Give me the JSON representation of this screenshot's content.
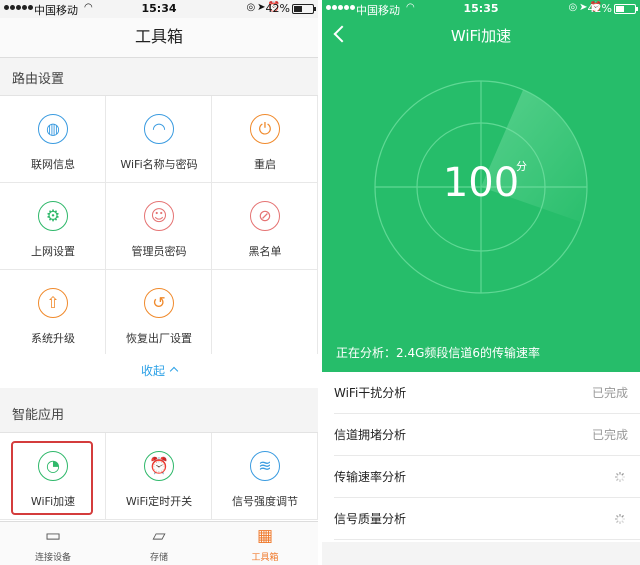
{
  "left": {
    "status": {
      "carrier": "中国移动",
      "time": "15:34",
      "battery": "42%",
      "battery_level": 0.42
    },
    "title": "工具箱",
    "router_section": {
      "title": "路由设置",
      "items": [
        {
          "label": "联网信息",
          "icon": "globe-icon",
          "color": "#3a9be0"
        },
        {
          "label": "WiFi名称与密码",
          "icon": "wifi-icon",
          "color": "#3a9be0"
        },
        {
          "label": "重启",
          "icon": "power-icon",
          "color": "#f08a2c"
        },
        {
          "label": "上网设置",
          "icon": "gear-icon",
          "color": "#2fb86a"
        },
        {
          "label": "管理员密码",
          "icon": "user-icon",
          "color": "#e57373"
        },
        {
          "label": "黑名单",
          "icon": "blacklist-icon",
          "color": "#e57373"
        },
        {
          "label": "系统升级",
          "icon": "upgrade-icon",
          "color": "#f08a2c"
        },
        {
          "label": "恢复出厂设置",
          "icon": "restore-icon",
          "color": "#f08a2c"
        }
      ],
      "collapse_label": "收起"
    },
    "smart_section": {
      "title": "智能应用",
      "items": [
        {
          "label": "WiFi加速",
          "icon": "speedometer-icon",
          "color": "#2fb86a"
        },
        {
          "label": "WiFi定时开关",
          "icon": "alarm-clock-icon",
          "color": "#2fb86a"
        },
        {
          "label": "信号强度调节",
          "icon": "signal-icon",
          "color": "#3a9be0"
        }
      ]
    },
    "tabs": [
      {
        "label": "连接设备",
        "icon": "monitor-icon"
      },
      {
        "label": "存储",
        "icon": "storage-icon"
      },
      {
        "label": "工具箱",
        "icon": "toolbox-icon",
        "active": true
      }
    ],
    "accent": "#f07a2c"
  },
  "right": {
    "status": {
      "carrier": "中国移动",
      "time": "15:35",
      "battery": "42%",
      "battery_level": 0.42
    },
    "title": "WiFi加速",
    "score": "100",
    "unit": "分",
    "analyzing": "正在分析：2.4G频段信道6的传输速率",
    "rows": [
      {
        "label": "WiFi干扰分析",
        "status": "已完成"
      },
      {
        "label": "信道拥堵分析",
        "status": "已完成"
      },
      {
        "label": "传输速率分析",
        "status": "",
        "loading": true
      },
      {
        "label": "信号质量分析",
        "status": "",
        "loading": true
      }
    ],
    "bg_color": "#26bd6a"
  }
}
